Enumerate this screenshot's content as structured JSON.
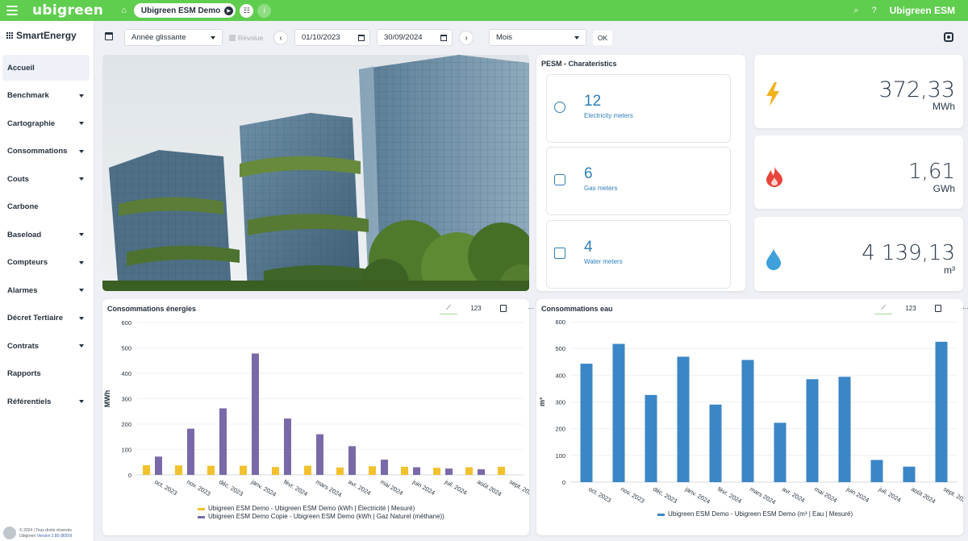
{
  "topbar": {
    "logo": "ubigreen",
    "site_selector": "Ubigreen ESM Demo",
    "user_name": "Ubigreen ESM",
    "icons": [
      "menu-icon",
      "home-icon",
      "play-icon",
      "hierarchy-icon",
      "info-icon",
      "search-icon",
      "help-icon"
    ]
  },
  "sidebar": {
    "brand": "SmartEnergy",
    "items": [
      {
        "label": "Accueil",
        "active": true,
        "expandable": false
      },
      {
        "label": "Benchmark",
        "expandable": true
      },
      {
        "label": "Cartographie",
        "expandable": true
      },
      {
        "label": "Consommations",
        "expandable": true
      },
      {
        "label": "Couts",
        "expandable": true
      },
      {
        "label": "Carbone",
        "expandable": false
      },
      {
        "label": "Baseload",
        "expandable": true
      },
      {
        "label": "Compteurs",
        "expandable": true
      },
      {
        "label": "Alarmes",
        "expandable": true
      },
      {
        "label": "Décret Tertiaire",
        "expandable": true
      },
      {
        "label": "Contrats",
        "expandable": true
      },
      {
        "label": "Rapports",
        "expandable": false
      },
      {
        "label": "Référentiels",
        "expandable": true
      }
    ],
    "footer_line1": "© 2024 | Tous droits réservés",
    "footer_line2_prefix": "Ubigreen ",
    "footer_version": "Version 2.80 (8050)"
  },
  "filters": {
    "period_type": "Année glissante",
    "revolue_label": "Révolue",
    "prev_symbol": "‹",
    "next_symbol": "›",
    "start_date": "01/10/2023",
    "end_date": "30/09/2024",
    "granularity": "Mois",
    "ok_label": "OK"
  },
  "pesm": {
    "title": "PESM - Charateristics",
    "meters": [
      {
        "count": "12",
        "label": "Electricity meters",
        "icon": "electricity-meter-icon"
      },
      {
        "count": "6",
        "label": "Gas meters",
        "icon": "gas-meter-icon"
      },
      {
        "count": "4",
        "label": "Water meters",
        "icon": "water-meter-icon"
      }
    ]
  },
  "kpis": [
    {
      "value": "372,33",
      "unit": "MWh",
      "icon": "lightning-icon",
      "color": "#f2b21c"
    },
    {
      "value": "1,61",
      "unit": "GWh",
      "icon": "flame-icon",
      "color": "#e8453c"
    },
    {
      "value": "4 139,13",
      "unit": "m³",
      "icon": "water-drop-icon",
      "color": "#3ea0dc"
    }
  ],
  "energy_chart": {
    "title": "Consommations énergies",
    "tools": {
      "numeric": "123"
    },
    "chart_data": {
      "type": "bar",
      "ylabel": "MWh",
      "ylim": [
        0,
        600
      ],
      "yticks": [
        0,
        100,
        200,
        300,
        400,
        500,
        600
      ],
      "categories": [
        "oct. 2023",
        "nov. 2023",
        "déc. 2023",
        "janv. 2024",
        "févr. 2024",
        "mars 2024",
        "avr. 2024",
        "mai 2024",
        "juin 2024",
        "juil. 2024",
        "août 2024",
        "sept. 2024"
      ],
      "series": [
        {
          "name": "Ubigreen ESM Demo - Ubigreen ESM Demo (kWh | Électricité | Mesuré)",
          "color": "#f2c12e",
          "values": [
            38,
            37,
            36,
            36,
            31,
            36,
            29,
            34,
            32,
            28,
            30,
            32
          ]
        },
        {
          "name": "Ubigreen ESM Demo Copie - Ubigreen ESM Demo (kWh | Gaz Naturel (méthane))",
          "color": "#7a69a8",
          "values": [
            72,
            182,
            262,
            478,
            222,
            160,
            113,
            60,
            30,
            25,
            22,
            0
          ]
        }
      ]
    }
  },
  "water_chart": {
    "title": "Consommations eau",
    "tools": {
      "numeric": "123"
    },
    "chart_data": {
      "type": "bar",
      "ylabel": "m³",
      "ylim": [
        0,
        600
      ],
      "yticks": [
        0,
        100,
        200,
        300,
        400,
        500,
        600
      ],
      "categories": [
        "oct. 2023",
        "nov. 2023",
        "déc. 2023",
        "janv. 2024",
        "févr. 2024",
        "mars 2024",
        "avr. 2024",
        "mai 2024",
        "juin 2024",
        "juil. 2024",
        "août 2024",
        "sept. 2024"
      ],
      "series": [
        {
          "name": "Ubigreen ESM Demo - Ubigreen ESM Demo (m³ | Eau | Mesuré)",
          "color": "#3b86c6",
          "values": [
            443,
            517,
            326,
            469,
            290,
            457,
            222,
            385,
            394,
            83,
            58,
            525
          ]
        }
      ]
    }
  }
}
